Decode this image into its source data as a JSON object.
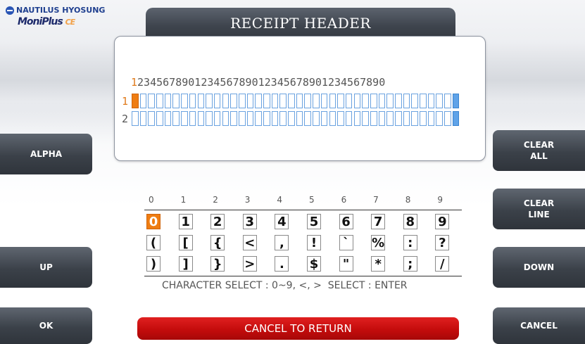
{
  "brand": {
    "company": "NAUTILUS HYOSUNG",
    "product": "MoniPlus",
    "product_suffix": "CE"
  },
  "title": "RECEIPT HEADER",
  "ruler": "1234567890123456789012345678901234567890",
  "rows": [
    {
      "number": "1",
      "length": 40,
      "cursor_index": 0
    },
    {
      "number": "2",
      "length": 40
    }
  ],
  "char_columns": [
    "0",
    "1",
    "2",
    "3",
    "4",
    "5",
    "6",
    "7",
    "8",
    "9"
  ],
  "char_rows": [
    [
      "0",
      "1",
      "2",
      "3",
      "4",
      "5",
      "6",
      "7",
      "8",
      "9"
    ],
    [
      "(",
      "[",
      "{",
      "<",
      ",",
      "!",
      "`",
      "%",
      ":",
      "?"
    ],
    [
      ")",
      "]",
      "}",
      ">",
      ".",
      "$",
      "\"",
      "*",
      ";",
      "/"
    ]
  ],
  "selected_char": "0",
  "hint": "CHARACTER SELECT : 0~9, <, >  SELECT : ENTER",
  "buttons": {
    "alpha": "ALPHA",
    "up": "UP",
    "ok": "OK",
    "clear_all": "CLEAR\nALL",
    "clear_line": "CLEAR\nLINE",
    "down": "DOWN",
    "cancel": "CANCEL",
    "cancel_to_return": "CANCEL TO RETURN"
  },
  "colors": {
    "cursor": "#ef7d12",
    "cell_border": "#6aa2e0",
    "cancel_red": "#c40c0c",
    "button_dark": "#3b4149"
  }
}
